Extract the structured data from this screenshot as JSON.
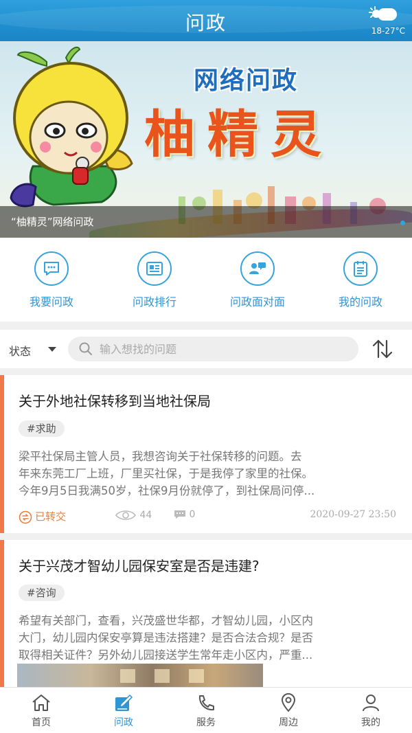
{
  "header": {
    "title": "问政",
    "weather_temp": "18-27°C",
    "weather_icon": "sun-cloud-icon"
  },
  "banner": {
    "subtitle": "网络问政",
    "main_title": "柚精灵",
    "caption": "“柚精灵”网络问政"
  },
  "quick_menu": [
    {
      "label": "我要问政",
      "icon": "message-icon"
    },
    {
      "label": "问政排行",
      "icon": "ranking-icon"
    },
    {
      "label": "问政面对面",
      "icon": "face-to-face-icon"
    },
    {
      "label": "我的问政",
      "icon": "my-list-icon"
    }
  ],
  "filter": {
    "status_label": "状态",
    "search_placeholder": "输入想找的问题"
  },
  "posts": [
    {
      "title": "关于外地社保转移到当地社保局",
      "tag": "#求助",
      "body_lines": [
        "梁平社保局主管人员，我想咨询关于社保转移的问题。去",
        "年来东莞工厂上班，厂里买社保，于是我停了家里的社保。",
        "今年9月5日我满50岁，社保9月份就停了，到社保局问停..."
      ],
      "status": "已转交",
      "views": "44",
      "comments": "0",
      "time": "2020-09-27 23:50"
    },
    {
      "title": "关于兴茂才智幼儿园保安室是否是违建?",
      "tag": "#咨询",
      "body_lines": [
        "希望有关部门，查看，兴茂盛世华都，才智幼儿园，小区内",
        "大门，幼儿园内保安亭算是违法搭建？是否合法合规？是否",
        "取得相关证件？另外幼儿园接送学生常年走小区内，严重..."
      ]
    }
  ],
  "nav": [
    {
      "label": "首页",
      "icon": "home-icon"
    },
    {
      "label": "问政",
      "icon": "edit-icon",
      "active": true
    },
    {
      "label": "服务",
      "icon": "phone-icon"
    },
    {
      "label": "周边",
      "icon": "location-icon"
    },
    {
      "label": "我的",
      "icon": "user-icon"
    }
  ],
  "colors": {
    "header_blue": "#1f8fd0",
    "accent_blue": "#2f95d3",
    "accent_orange": "#f0784a"
  }
}
